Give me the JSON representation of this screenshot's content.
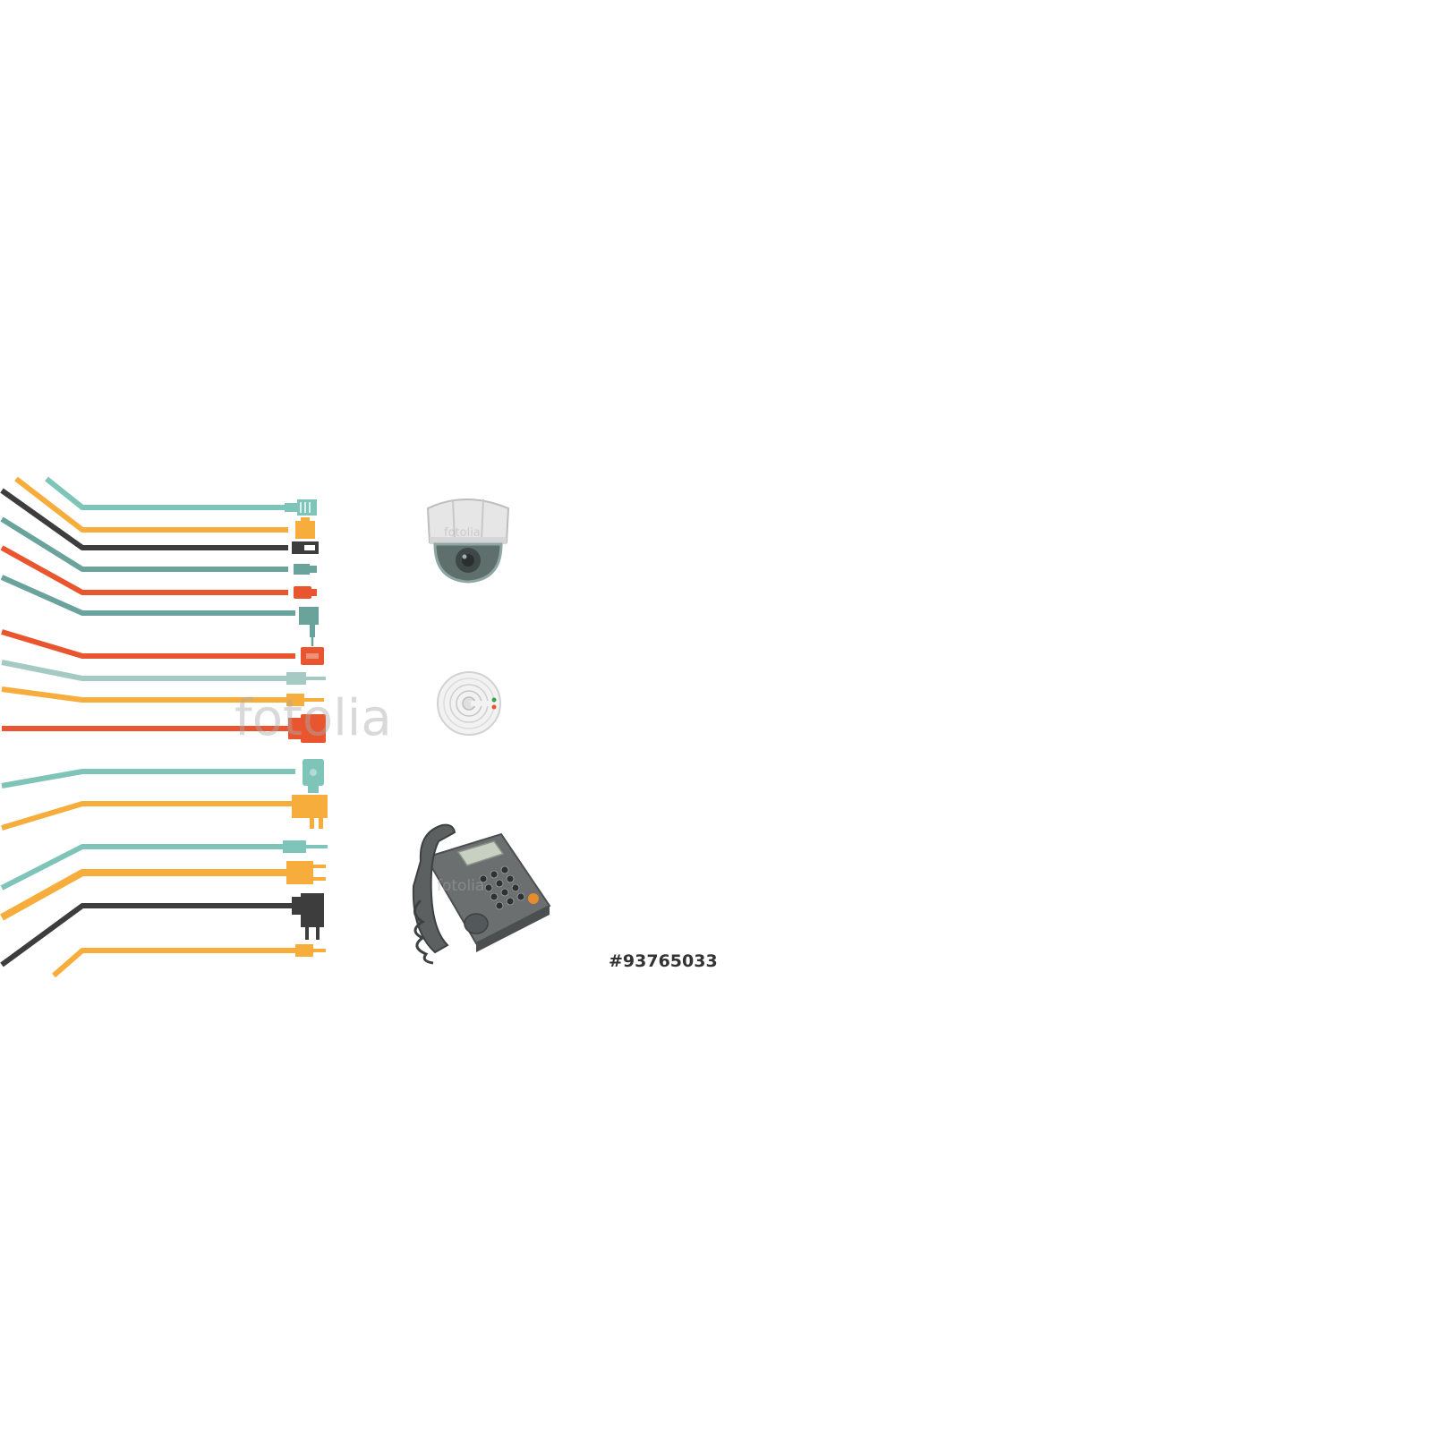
{
  "image": {
    "stock_id": "#93765033",
    "watermark_text": "fotolia"
  },
  "colors": {
    "teal": "#7fc4b8",
    "orange": "#f6ad3c",
    "dark": "#3d3d3d",
    "red": "#e8552e",
    "grey_teal": "#6aa39c",
    "light_teal": "#a5c9c3"
  },
  "cables": [
    {
      "color": "teal",
      "connector": "rj45-plug-icon"
    },
    {
      "color": "orange",
      "connector": "modular-plug-icon"
    },
    {
      "color": "dark",
      "connector": "usb-plug-icon"
    },
    {
      "color": "grey_teal",
      "connector": "mini-usb-plug-icon"
    },
    {
      "color": "red",
      "connector": "micro-plug-icon"
    },
    {
      "color": "grey_teal",
      "connector": "angled-jack-icon"
    },
    {
      "color": "red",
      "connector": "hdmi-plug-icon"
    },
    {
      "color": "light_teal",
      "connector": "audio-jack-icon"
    },
    {
      "color": "orange",
      "connector": "rca-plug-icon"
    },
    {
      "color": "red",
      "connector": "scart-plug-icon"
    },
    {
      "color": "teal",
      "connector": "dsub-plug-icon"
    },
    {
      "color": "orange",
      "connector": "adapter-plug-icon"
    },
    {
      "color": "teal",
      "connector": "stereo-jack-icon"
    },
    {
      "color": "orange",
      "connector": "power-plug-icon"
    },
    {
      "color": "dark",
      "connector": "wall-adapter-icon"
    },
    {
      "color": "orange",
      "connector": "barrel-plug-icon"
    }
  ],
  "devices": [
    "dome-camera-icon",
    "smoke-detector-icon",
    "desk-phone-icon"
  ]
}
